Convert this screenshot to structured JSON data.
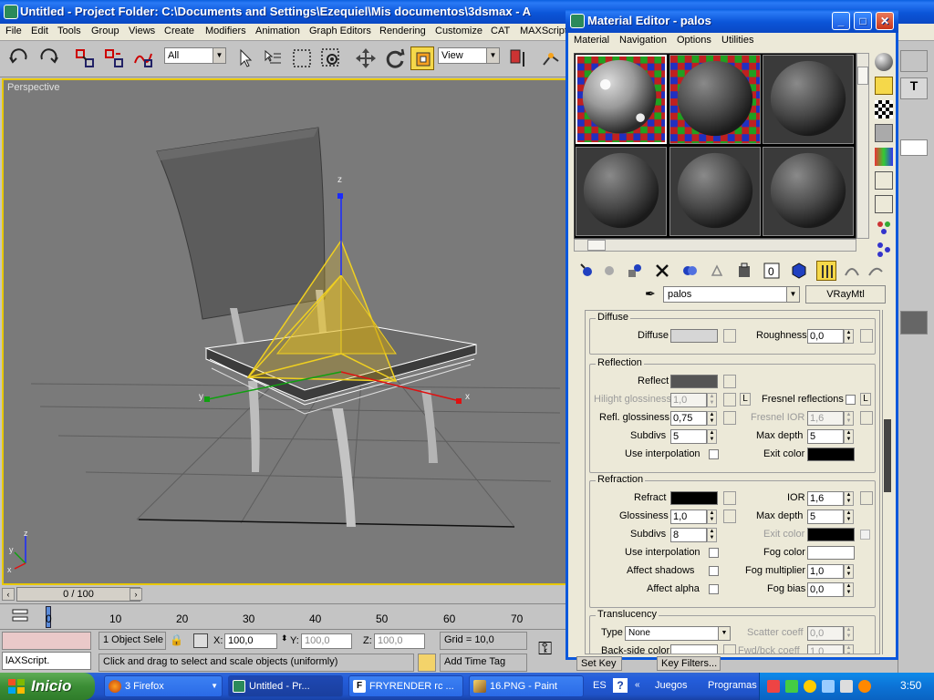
{
  "app": {
    "title": "Untitled    - Project Folder: C:\\Documents and Settings\\Ezequiel\\Mis documentos\\3dsmax    - A",
    "menu": [
      "File",
      "Edit",
      "Tools",
      "Group",
      "Views",
      "Create",
      "Modifiers",
      "Animation",
      "Graph Editors",
      "Rendering",
      "Customize",
      "CAT",
      "MAXScript"
    ],
    "selection_filter": "All",
    "coord_system": "View",
    "viewport_label": "Perspective",
    "axis_labels": {
      "x": "x",
      "y": "y",
      "z": "z"
    },
    "time_slider": "0 / 100",
    "timeline_ticks": [
      "0",
      "10",
      "20",
      "30",
      "40",
      "50",
      "60",
      "70"
    ],
    "status": {
      "selection": "1 Object Sele",
      "x_label": "X:",
      "x_value": "100,0",
      "y_label": "Y:",
      "y_value": "100,0",
      "z_label": "Z:",
      "z_value": "100,0",
      "grid": "Grid = 10,0",
      "prompt": "Click and drag to select and scale objects (uniformly)",
      "add_time_tag": "Add Time Tag",
      "maxscript": "lAXScript.",
      "set_key": "Set Key",
      "key_filters": "Key Filters..."
    }
  },
  "material_editor": {
    "title": "Material Editor - palos",
    "menu": [
      "Material",
      "Navigation",
      "Options",
      "Utilities"
    ],
    "material_name": "palos",
    "material_type": "VRayMtl",
    "diffuse": {
      "title": "Diffuse",
      "diffuse_label": "Diffuse",
      "diffuse_color": "#d6d6d6",
      "roughness_label": "Roughness",
      "roughness": "0,0"
    },
    "reflection": {
      "title": "Reflection",
      "reflect_label": "Reflect",
      "reflect_color": "#555555",
      "hilight_label": "Hilight glossiness",
      "hilight": "1,0",
      "fresnel_label": "Fresnel reflections",
      "refl_gloss_label": "Refl. glossiness",
      "refl_gloss": "0,75",
      "fresnel_ior_label": "Fresnel IOR",
      "fresnel_ior": "1,6",
      "subdivs_label": "Subdivs",
      "subdivs": "5",
      "max_depth_label": "Max depth",
      "max_depth": "5",
      "use_interp_label": "Use interpolation",
      "exit_color_label": "Exit color",
      "exit_color": "#000000",
      "l_label": "L"
    },
    "refraction": {
      "title": "Refraction",
      "refract_label": "Refract",
      "refract_color": "#000000",
      "ior_label": "IOR",
      "ior": "1,6",
      "gloss_label": "Glossiness",
      "gloss": "1,0",
      "max_depth_label": "Max depth",
      "max_depth": "5",
      "subdivs_label": "Subdivs",
      "subdivs": "8",
      "exit_color_label": "Exit color",
      "exit_color": "#000000",
      "use_interp_label": "Use interpolation",
      "fog_color_label": "Fog color",
      "fog_color": "#ffffff",
      "affect_shadows_label": "Affect shadows",
      "fog_mult_label": "Fog multiplier",
      "fog_mult": "1,0",
      "affect_alpha_label": "Affect alpha",
      "fog_bias_label": "Fog bias",
      "fog_bias": "0,0"
    },
    "translucency": {
      "title": "Translucency",
      "type_label": "Type",
      "type": "None",
      "scatter_label": "Scatter coeff",
      "scatter": "0,0",
      "backside_label": "Back-side color",
      "backside_color": "#ffffff",
      "fwd_label": "Fwd/bck coeff",
      "fwd": "1,0"
    }
  },
  "taskbar": {
    "start": "Inicio",
    "tasks": [
      "3 Firefox",
      "Untitled    - Pr...",
      "FRYRENDER rc ...",
      "16.PNG - Paint"
    ],
    "tray_lang": "ES",
    "juegos": "Juegos",
    "programas": "Programas",
    "clock": "3:50"
  },
  "colors": {
    "xp_blue": "#0b55d8",
    "viewport_selected_border": "#e8c800",
    "gizmo_yellow": "#e8c020"
  }
}
